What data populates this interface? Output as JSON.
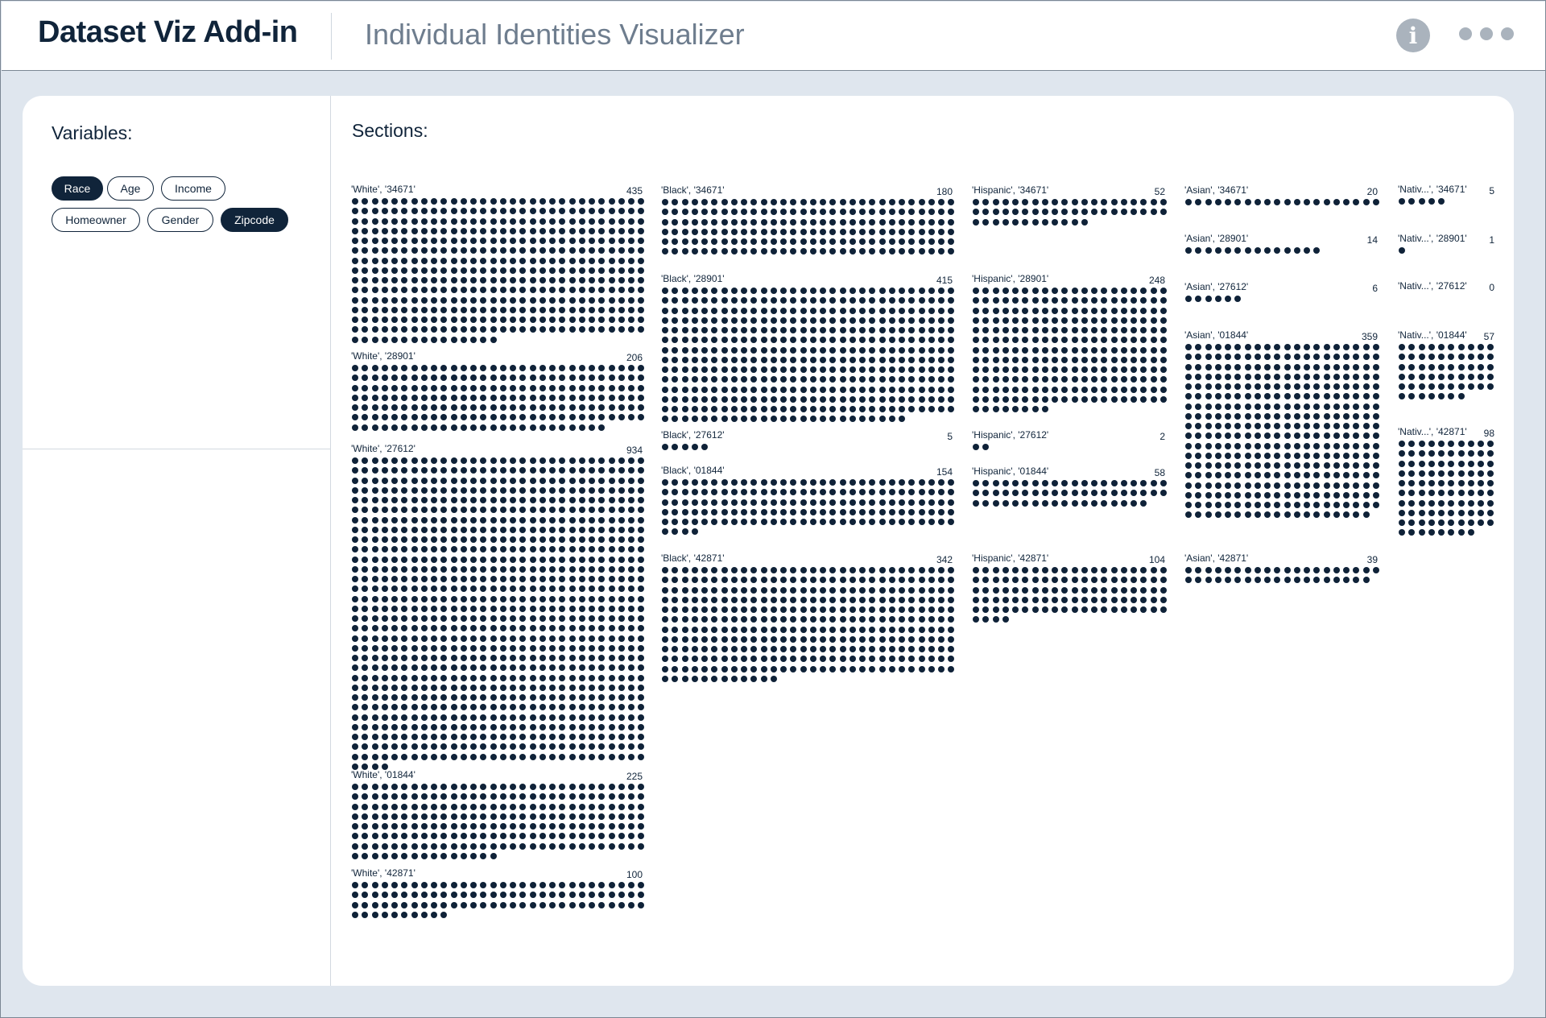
{
  "header": {
    "title": "Dataset Viz Add-in",
    "subtitle": "Individual Identities Visualizer",
    "info_icon": "info-icon",
    "more_icon": "more-horizontal-icon"
  },
  "sidebar": {
    "heading": "Variables:",
    "chips": [
      {
        "label": "Race",
        "selected": true
      },
      {
        "label": "Age",
        "selected": false
      },
      {
        "label": "Income",
        "selected": false
      },
      {
        "label": "Homeowner",
        "selected": false
      },
      {
        "label": "Gender",
        "selected": false
      },
      {
        "label": "Zipcode",
        "selected": true
      }
    ]
  },
  "main": {
    "heading": "Sections:"
  },
  "colors": {
    "accent": "#10243a",
    "dot": "#0f2238",
    "background": "#dfe6ee",
    "muted": "#aab3bd"
  },
  "chart_data": {
    "type": "unit-dot",
    "columns": [
      {
        "race": "White",
        "sections": [
          {
            "label": "'White', '34671'",
            "count": 435
          },
          {
            "label": "'White', '28901'",
            "count": 206
          },
          {
            "label": "'White', '27612'",
            "count": 934
          },
          {
            "label": "'White', '01844'",
            "count": 225
          },
          {
            "label": "'White', '42871'",
            "count": 100
          }
        ]
      },
      {
        "race": "Black",
        "sections": [
          {
            "label": "'Black', '34671'",
            "count": 180
          },
          {
            "label": "'Black', '28901'",
            "count": 415
          },
          {
            "label": "'Black', '27612'",
            "count": 5
          },
          {
            "label": "'Black', '01844'",
            "count": 154
          },
          {
            "label": "'Black', '42871'",
            "count": 342
          }
        ]
      },
      {
        "race": "Hispanic",
        "sections": [
          {
            "label": "'Hispanic', '34671'",
            "count": 52
          },
          {
            "label": "'Hispanic', '28901'",
            "count": 248
          },
          {
            "label": "'Hispanic', '27612'",
            "count": 2
          },
          {
            "label": "'Hispanic', '01844'",
            "count": 58
          },
          {
            "label": "'Hispanic', '42871'",
            "count": 104
          }
        ]
      },
      {
        "race": "Asian",
        "sections": [
          {
            "label": "'Asian', '34671'",
            "count": 20
          },
          {
            "label": "'Asian', '28901'",
            "count": 14
          },
          {
            "label": "'Asian', '27612'",
            "count": 6
          },
          {
            "label": "'Asian', '01844'",
            "count": 359
          },
          {
            "label": "'Asian', '42871'",
            "count": 39
          }
        ]
      },
      {
        "race": "Nativ...",
        "sections": [
          {
            "label": "'Nativ...', '34671'",
            "count": 5
          },
          {
            "label": "'Nativ...', '28901'",
            "count": 1
          },
          {
            "label": "'Nativ...', '27612'",
            "count": 0
          },
          {
            "label": "'Nativ...', '01844'",
            "count": 57
          },
          {
            "label": "'Nativ...', '42871'",
            "count": 98
          }
        ]
      }
    ]
  }
}
